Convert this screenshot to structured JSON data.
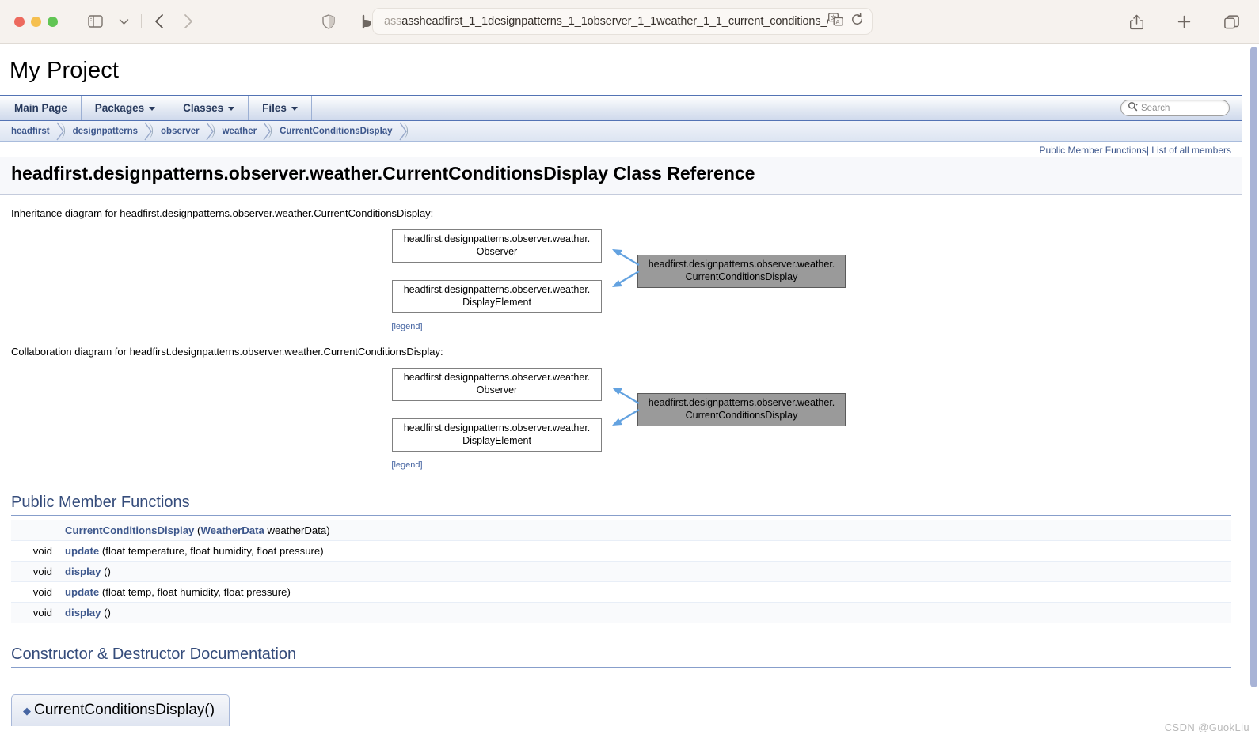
{
  "browser": {
    "url": "assheadfirst_1_1designpatterns_1_1observer_1_1weather_1_1_current_conditions_display.html",
    "url_faded_prefix": "ass",
    "icons": {
      "sidebar": "sidebar-icon",
      "sidebar_chevron": "chevron-down-icon",
      "back": "back-arrow-icon",
      "forward": "forward-arrow-icon",
      "shield": "shield-icon",
      "reader": "reader-icon",
      "translate": "translate-icon",
      "reload": "reload-icon",
      "share": "share-icon",
      "new_tab": "plus-icon",
      "tab_overview": "tab-overview-icon"
    }
  },
  "doc": {
    "project_name": "My Project",
    "tabs": [
      {
        "label": "Main Page",
        "has_caret": false
      },
      {
        "label": "Packages",
        "has_caret": true
      },
      {
        "label": "Classes",
        "has_caret": true
      },
      {
        "label": "Files",
        "has_caret": true
      }
    ],
    "search": {
      "placeholder": "Search"
    },
    "breadcrumbs": [
      "headfirst",
      "designpatterns",
      "observer",
      "weather",
      "CurrentConditionsDisplay"
    ],
    "summary_links": [
      "Public Member Functions",
      "List of all members"
    ],
    "summary_separator": "|",
    "page_title": "headfirst.designpatterns.observer.weather.CurrentConditionsDisplay Class Reference",
    "inheritance": {
      "caption": "Inheritance diagram for headfirst.designpatterns.observer.weather.CurrentConditionsDisplay:",
      "nodes": [
        {
          "line1": "headfirst.designpatterns.observer.weather.",
          "line2": "Observer",
          "current": false
        },
        {
          "line1": "headfirst.designpatterns.observer.weather.",
          "line2": "DisplayElement",
          "current": false
        },
        {
          "line1": "headfirst.designpatterns.observer.weather.",
          "line2": "CurrentConditionsDisplay",
          "current": true
        }
      ],
      "legend": "[legend]"
    },
    "collaboration": {
      "caption": "Collaboration diagram for headfirst.designpatterns.observer.weather.CurrentConditionsDisplay:",
      "nodes": [
        {
          "line1": "headfirst.designpatterns.observer.weather.",
          "line2": "Observer",
          "current": false
        },
        {
          "line1": "headfirst.designpatterns.observer.weather.",
          "line2": "DisplayElement",
          "current": false
        },
        {
          "line1": "headfirst.designpatterns.observer.weather.",
          "line2": "CurrentConditionsDisplay",
          "current": true
        }
      ],
      "legend": "[legend]"
    },
    "public_member_functions": {
      "heading": "Public Member Functions",
      "rows": [
        {
          "type": "",
          "name": "CurrentConditionsDisplay",
          "args_pre": " (",
          "args_link": "WeatherData",
          "args_post": " weatherData)"
        },
        {
          "type": "void",
          "name": "update",
          "args_pre": " (float temperature, float humidity, float pressure)",
          "args_link": "",
          "args_post": ""
        },
        {
          "type": "void",
          "name": "display",
          "args_pre": " ()",
          "args_link": "",
          "args_post": ""
        },
        {
          "type": "void",
          "name": "update",
          "args_pre": " (float temp, float humidity, float pressure)",
          "args_link": "",
          "args_post": ""
        },
        {
          "type": "void",
          "name": "display",
          "args_pre": " ()",
          "args_link": "",
          "args_post": ""
        }
      ]
    },
    "constructor_section": {
      "heading": "Constructor & Destructor Documentation",
      "member_title": "CurrentConditionsDisplay()",
      "bullet": "◆"
    }
  },
  "watermark": "CSDN @GuokLiu",
  "colors": {
    "doxygen_blue": "#3d578c",
    "heading_blue": "#354c7b",
    "tab_border": "#5373b4",
    "arrow_blue": "#63a2e0",
    "node_current_bg": "#9a9a9a"
  }
}
